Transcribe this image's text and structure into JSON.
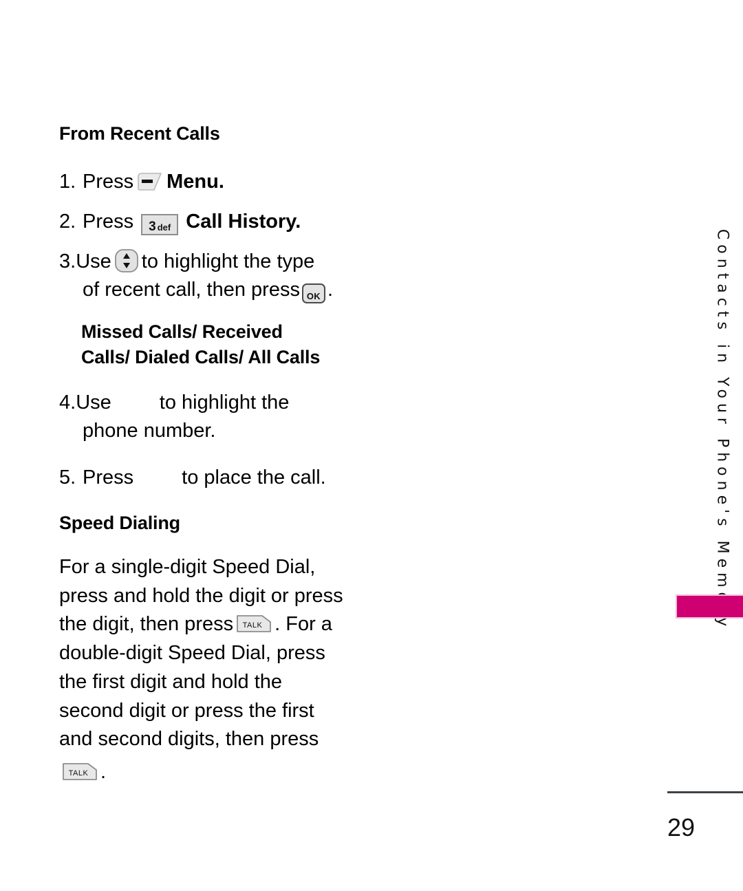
{
  "page": {
    "number": "29",
    "running_head": "Contacts in Your Phone's Memory",
    "accent_color": "#ce0072",
    "accent_border_color": "#f4bedb",
    "rule_color": "#3d4246"
  },
  "sections": {
    "recent_calls": {
      "heading": "From Recent Calls",
      "steps": [
        {
          "number": "1.",
          "verb": "Press",
          "icon": "menu-softkey-icon",
          "after": "Menu.",
          "after_bold": true
        },
        {
          "number": "2.",
          "verb": "Press",
          "icon": "keypad-key-3-def-icon",
          "key_digit": "3",
          "key_letters": "def",
          "after": "Call History.",
          "after_bold": true
        },
        {
          "number": "3.",
          "verb": "Use",
          "icon": "navigation-up-down-key-icon",
          "line1_after": "to highlight the type",
          "line2_before": "of recent call, then press",
          "line2_icon": "ok-key-icon",
          "ok_label": "OK",
          "line2_after": "."
        },
        {
          "number": "4.",
          "verb": "Use",
          "icon": "missing-icon-placeholder",
          "line1_after": "to highlight the",
          "line2": "phone number."
        },
        {
          "number": "5.",
          "verb": "Press",
          "icon": "missing-icon-placeholder",
          "line1_after": "to place the call."
        }
      ],
      "call_type_list": {
        "line1": "Missed Calls/ Received",
        "line2": "Calls/ Dialed Calls/ All Calls"
      }
    },
    "speed_dialing": {
      "heading": "Speed Dialing",
      "paragraph_lines": [
        "For a single-digit Speed Dial,",
        "press and hold the digit or press",
        "the digit, then press",
        ". For a",
        "double-digit Speed Dial, press",
        "the first digit and hold the",
        "second digit or press the first",
        "and second digits, then press",
        "."
      ],
      "talk_key_label": "TALK"
    }
  }
}
